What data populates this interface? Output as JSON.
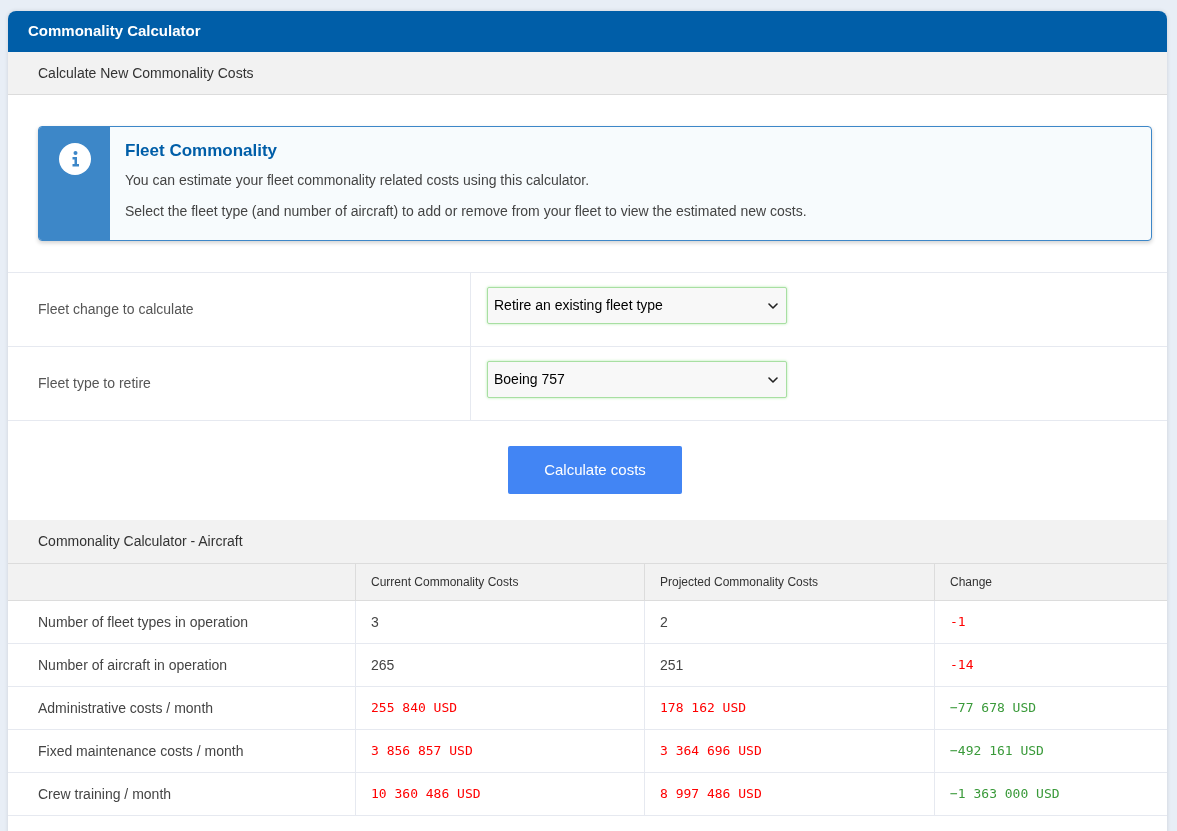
{
  "panel": {
    "title": "Commonality Calculator"
  },
  "calculator": {
    "heading": "Calculate New Commonality Costs",
    "info": {
      "title": "Fleet Commonality",
      "lines": [
        "You can estimate your fleet commonality related costs using this calculator.",
        "Select the fleet type (and number of aircraft) to add or remove from your fleet to view the estimated new costs."
      ]
    },
    "fields": [
      {
        "label": "Fleet change to calculate",
        "value": "Retire an existing fleet type"
      },
      {
        "label": "Fleet type to retire",
        "value": "Boeing 757"
      }
    ],
    "button": "Calculate costs"
  },
  "results": {
    "heading": "Commonality Calculator - Aircraft",
    "columns": [
      "Current Commonality Costs",
      "Projected Commonality Costs",
      "Change"
    ],
    "rows": [
      {
        "label": "Number of fleet types in operation",
        "cells": [
          {
            "text": "3",
            "kind": "plain"
          },
          {
            "text": "2",
            "kind": "plain"
          },
          {
            "text": "-1",
            "kind": "loss"
          }
        ]
      },
      {
        "label": "Number of aircraft in operation",
        "cells": [
          {
            "text": "265",
            "kind": "plain"
          },
          {
            "text": "251",
            "kind": "plain"
          },
          {
            "text": "-14",
            "kind": "loss"
          }
        ]
      },
      {
        "label": "Administrative costs / month",
        "cells": [
          {
            "text": "255 840 USD",
            "kind": "loss"
          },
          {
            "text": "178 162 USD",
            "kind": "loss"
          },
          {
            "text": "−77 678 USD",
            "kind": "gain"
          }
        ]
      },
      {
        "label": "Fixed maintenance costs / month",
        "cells": [
          {
            "text": "3 856 857 USD",
            "kind": "loss"
          },
          {
            "text": "3 364 696 USD",
            "kind": "loss"
          },
          {
            "text": "−492 161 USD",
            "kind": "gain"
          }
        ]
      },
      {
        "label": "Crew training / month",
        "cells": [
          {
            "text": "10 360 486 USD",
            "kind": "loss"
          },
          {
            "text": "8 997 486 USD",
            "kind": "loss"
          },
          {
            "text": "−1 363 000 USD",
            "kind": "gain"
          }
        ]
      }
    ]
  }
}
